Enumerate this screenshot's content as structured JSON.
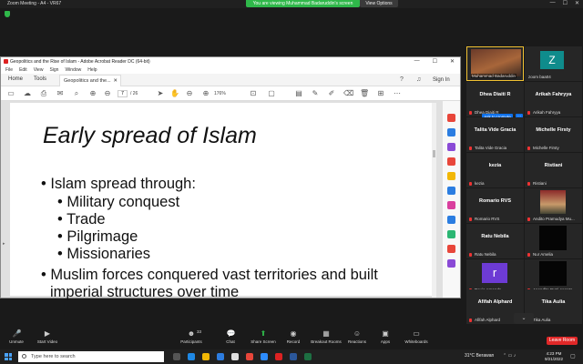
{
  "zoom": {
    "window_title": "Zoom Meeting - A4 - VR67",
    "share_banner": "You are viewing Muhammad Badaruddin's screen",
    "view_options": "View Options"
  },
  "acrobat": {
    "title": "Geopolitics and the Rise of Islam - Adobe Acrobat Reader DC (64-bit)",
    "menu": [
      "File",
      "Edit",
      "View",
      "Sign",
      "Window",
      "Help"
    ],
    "tabs": {
      "home": "Home",
      "tools": "Tools",
      "doc": "Geopolitics and the..."
    },
    "sign_in": "Sign In",
    "page_current": "7",
    "page_total": "/ 26",
    "zoom_level": "176%"
  },
  "slide": {
    "title": "Early spread of Islam",
    "bullets": [
      "• Islam spread through:",
      "• Military conquest",
      "• Trade",
      "• Pilgrimage",
      "• Missionaries",
      "• Muslim forces conquered vast territories and built",
      "imperial structures over time"
    ]
  },
  "participants": [
    {
      "big": "",
      "sub": "Muhammad Badaruddin",
      "video": true
    },
    {
      "big": "Z",
      "sub": "zoom baa04",
      "avatar_color": "#0f8c8c"
    },
    {
      "big": "Dhea Diaiti R",
      "sub": "Dhea Diaiti R"
    },
    {
      "big": "Arikah Fahryya",
      "sub": "Arikah Fahryya"
    },
    {
      "big": "Talita Vide Gracia",
      "sub": "Talita Vide Gracia"
    },
    {
      "big": "Michelle Firsty",
      "sub": "Michelle Firsty"
    },
    {
      "big": "kezia",
      "sub": "kezia"
    },
    {
      "big": "Ristiani",
      "sub": "Ristiani"
    },
    {
      "big": "Romario RVS",
      "sub": "Romario RVS"
    },
    {
      "big": "",
      "sub": "Andito Pramudya Mu...",
      "photo": true
    },
    {
      "big": "Ratu Nebila",
      "sub": "Ratu Nebila"
    },
    {
      "big": "",
      "sub": "Nur Amelia",
      "dark": true
    },
    {
      "big": "r",
      "sub": "Revia Amanda",
      "avatar_color": "#6d3bd4"
    },
    {
      "big": "",
      "sub": "Anandita Putri Ananta",
      "dark": true
    },
    {
      "big": "Afifah Alphard",
      "sub": "Afifah Alphard"
    },
    {
      "big": "Tika Aulia",
      "sub": "Tika Aulia"
    }
  ],
  "add_unmute": "Ask to Unmute",
  "controls": [
    {
      "label": "Unmute",
      "icon": "mic-icon"
    },
    {
      "label": "Start Video",
      "icon": "video-icon"
    },
    {
      "label": "Participants",
      "icon": "participants-icon",
      "count": "33"
    },
    {
      "label": "Chat",
      "icon": "chat-icon"
    },
    {
      "label": "Share Screen",
      "icon": "share-icon"
    },
    {
      "label": "Record",
      "icon": "record-icon"
    },
    {
      "label": "Breakout Rooms",
      "icon": "breakout-icon"
    },
    {
      "label": "Reactions",
      "icon": "reaction-icon"
    },
    {
      "label": "Apps",
      "icon": "apps-icon"
    },
    {
      "label": "Whiteboards",
      "icon": "whiteboard-icon"
    }
  ],
  "leave": "Leave Room",
  "taskbar": {
    "search_placeholder": "Type here to search",
    "weather": "31°C Berawan",
    "time": "4:23 PM",
    "date": "9/21/2022"
  }
}
